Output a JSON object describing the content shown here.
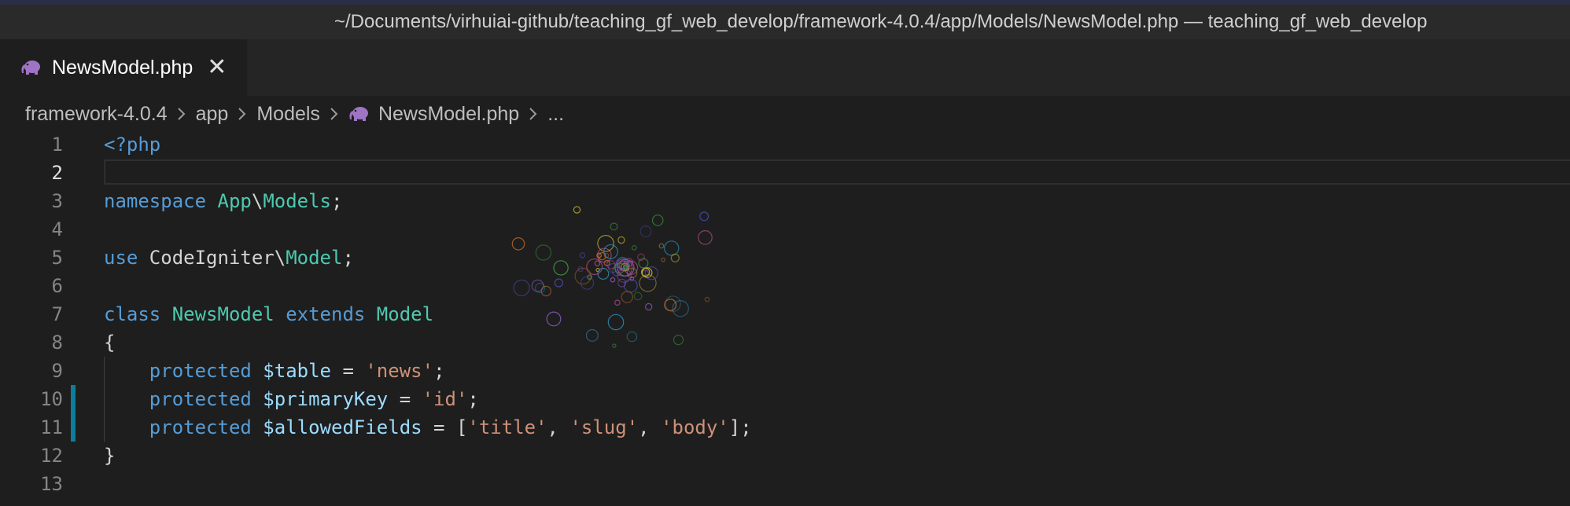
{
  "window": {
    "title": "~/Documents/virhuiai-github/teaching_gf_web_develop/framework-4.0.4/app/Models/NewsModel.php — teaching_gf_web_develop"
  },
  "tab": {
    "label": "NewsModel.php",
    "close_symbol": "✕",
    "icon": "php-elephant-icon",
    "icon_color": "#a074c4"
  },
  "breadcrumb": {
    "items": [
      "framework-4.0.4",
      "app",
      "Models",
      "NewsModel.php",
      "..."
    ]
  },
  "editor": {
    "active_line": 2,
    "modified_lines": [
      10,
      11
    ],
    "lines": [
      {
        "n": "1",
        "tokens": [
          {
            "t": "<?php",
            "c": "tag"
          }
        ]
      },
      {
        "n": "2",
        "tokens": []
      },
      {
        "n": "3",
        "tokens": [
          {
            "t": "namespace ",
            "c": "kw"
          },
          {
            "t": "App",
            "c": "ty"
          },
          {
            "t": "\\",
            "c": "pl"
          },
          {
            "t": "Models",
            "c": "ty"
          },
          {
            "t": ";",
            "c": "pl"
          }
        ]
      },
      {
        "n": "4",
        "tokens": []
      },
      {
        "n": "5",
        "tokens": [
          {
            "t": "use ",
            "c": "kw"
          },
          {
            "t": "CodeIgniter\\",
            "c": "pl"
          },
          {
            "t": "Model",
            "c": "ty"
          },
          {
            "t": ";",
            "c": "pl"
          }
        ]
      },
      {
        "n": "6",
        "tokens": []
      },
      {
        "n": "7",
        "tokens": [
          {
            "t": "class ",
            "c": "kw"
          },
          {
            "t": "NewsModel",
            "c": "ty"
          },
          {
            "t": " extends ",
            "c": "kw"
          },
          {
            "t": "Model",
            "c": "ty"
          }
        ]
      },
      {
        "n": "8",
        "tokens": [
          {
            "t": "{",
            "c": "pl"
          }
        ]
      },
      {
        "n": "9",
        "tokens": [
          {
            "t": "    ",
            "c": "pl"
          },
          {
            "t": "protected ",
            "c": "kw"
          },
          {
            "t": "$table",
            "c": "var"
          },
          {
            "t": " = ",
            "c": "pl"
          },
          {
            "t": "'news'",
            "c": "str"
          },
          {
            "t": ";",
            "c": "pl"
          }
        ]
      },
      {
        "n": "10",
        "tokens": [
          {
            "t": "    ",
            "c": "pl"
          },
          {
            "t": "protected ",
            "c": "kw"
          },
          {
            "t": "$primaryKey",
            "c": "var"
          },
          {
            "t": " = ",
            "c": "pl"
          },
          {
            "t": "'id'",
            "c": "str"
          },
          {
            "t": ";",
            "c": "pl"
          }
        ]
      },
      {
        "n": "11",
        "tokens": [
          {
            "t": "    ",
            "c": "pl"
          },
          {
            "t": "protected ",
            "c": "kw"
          },
          {
            "t": "$allowedFields",
            "c": "var"
          },
          {
            "t": " = [",
            "c": "pl"
          },
          {
            "t": "'title'",
            "c": "str"
          },
          {
            "t": ", ",
            "c": "pl"
          },
          {
            "t": "'slug'",
            "c": "str"
          },
          {
            "t": ", ",
            "c": "pl"
          },
          {
            "t": "'body'",
            "c": "str"
          },
          {
            "t": "];",
            "c": "pl"
          }
        ]
      },
      {
        "n": "12",
        "tokens": [
          {
            "t": "}",
            "c": "pl"
          }
        ]
      },
      {
        "n": "13",
        "tokens": []
      }
    ]
  },
  "colors": {
    "editor_background": "#1e1e1e",
    "title_bar": "#2a2a2a",
    "tab_strip": "#252526",
    "modified_gutter": "#0c7d9d",
    "keyword": "#569cd6",
    "type": "#4ec9b0",
    "variable": "#9cdcfe",
    "string": "#ce9178"
  }
}
